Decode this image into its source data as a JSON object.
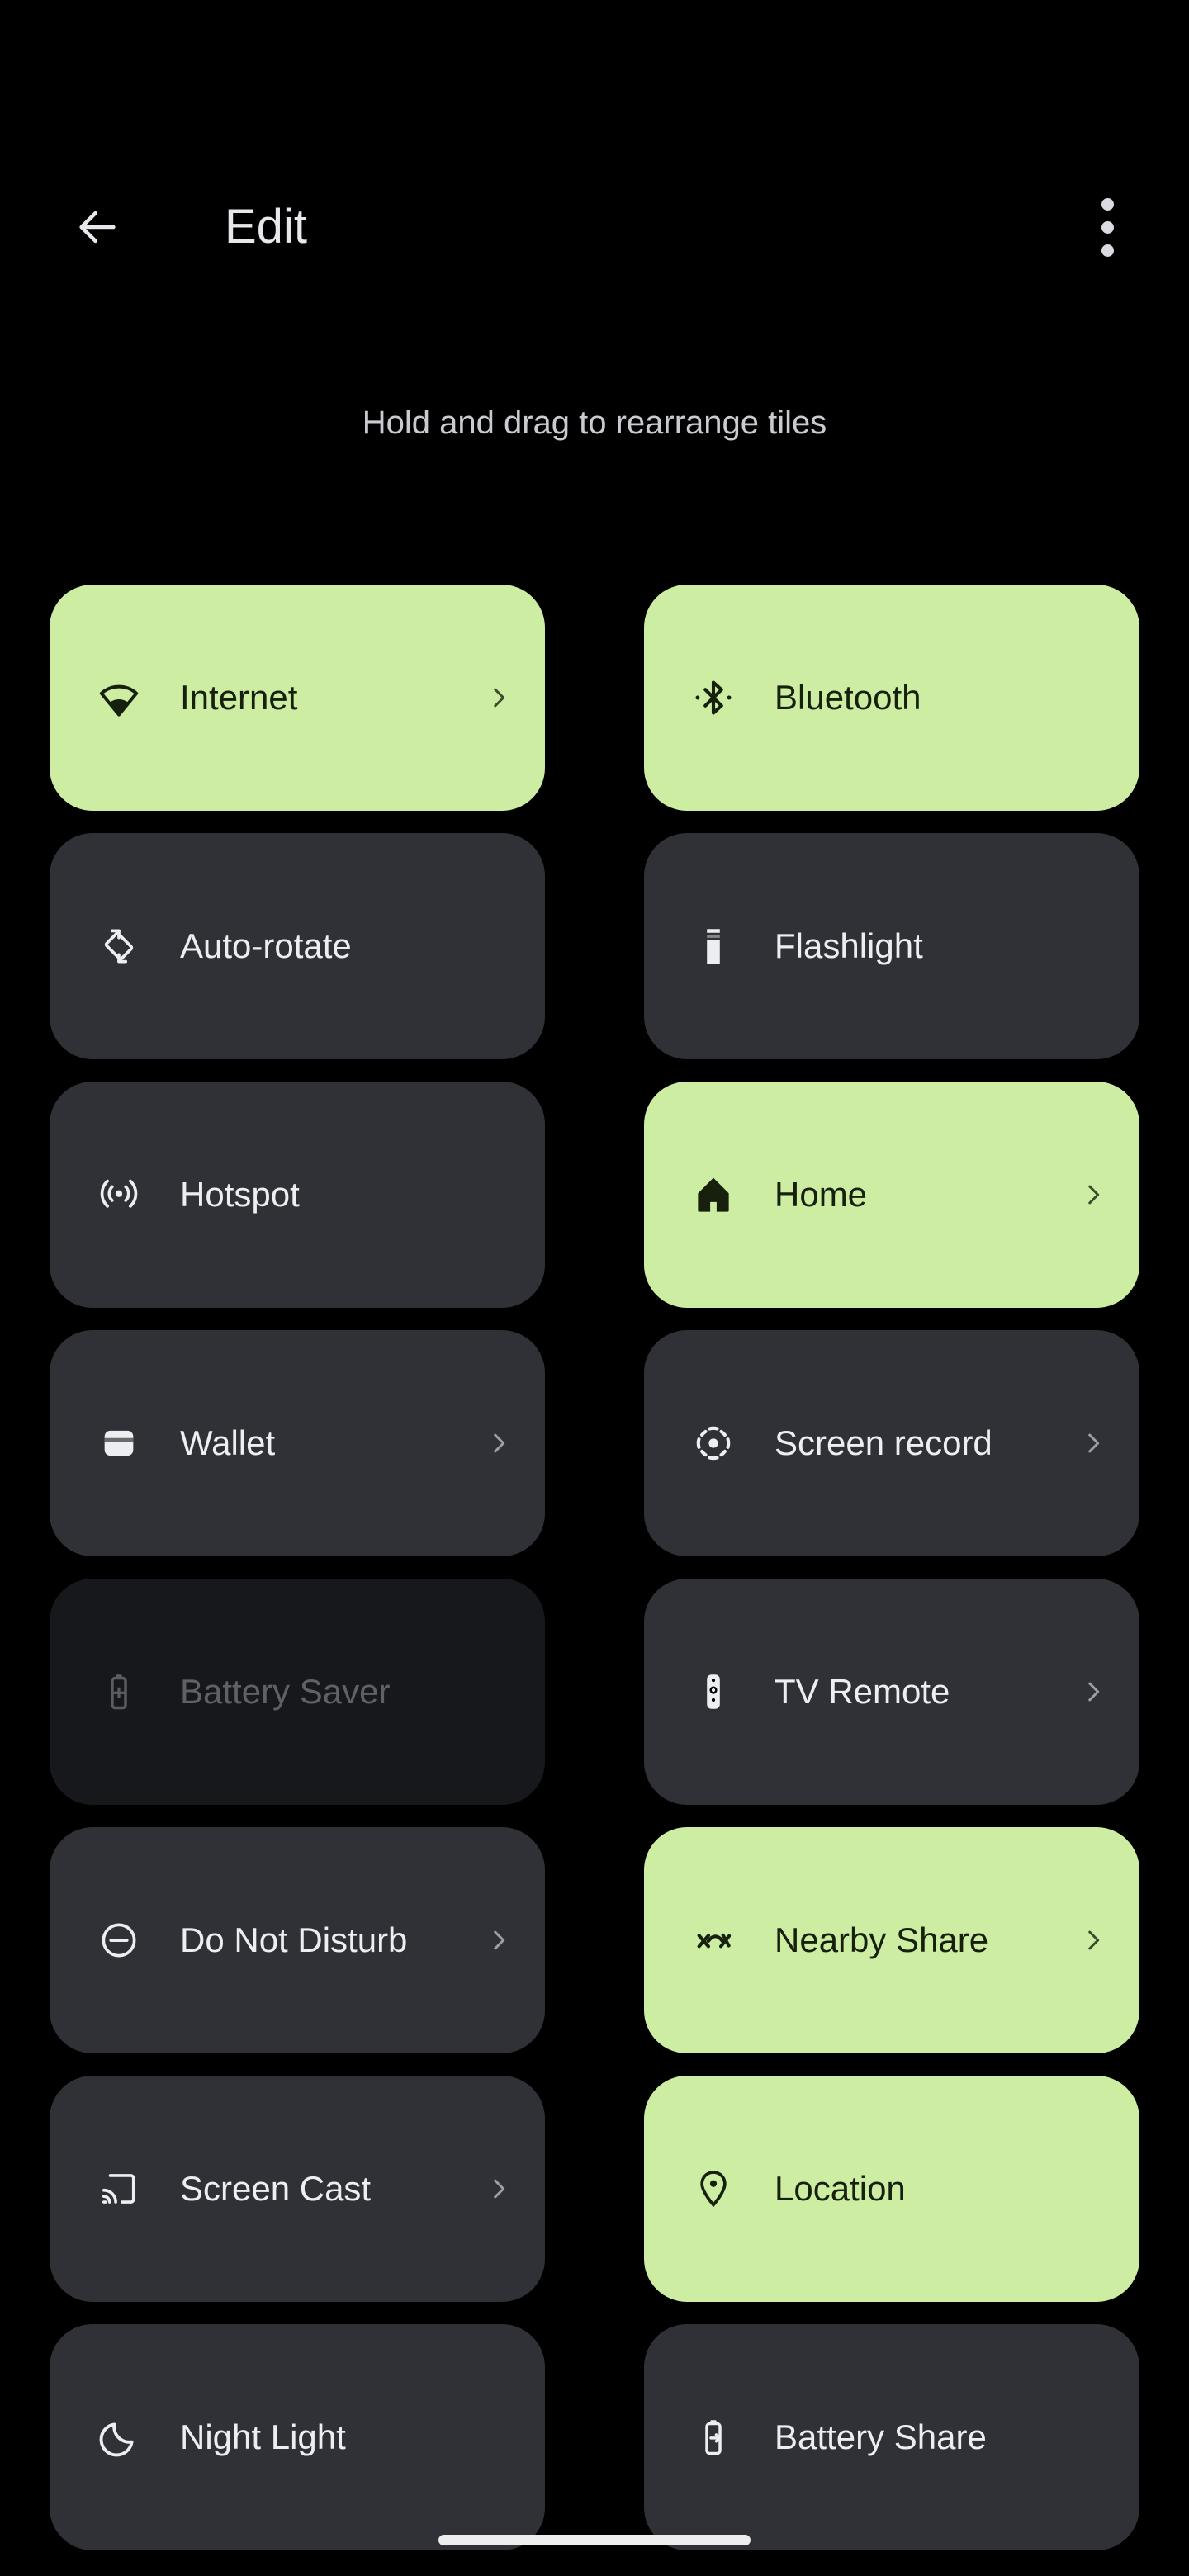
{
  "appbar": {
    "back_icon": "arrow-left-icon",
    "title": "Edit",
    "overflow_icon": "more-vert-icon"
  },
  "subtitle": "Hold and drag to rearrange tiles",
  "colors": {
    "background": "#000000",
    "tile_active": "#CDEDA3",
    "tile_inactive": "#2F3136",
    "tile_disabled": "#17181C",
    "text_on_active": "#16200C",
    "text_on_inactive": "#EDEEF2",
    "text_disabled": "#5F6166",
    "title_text": "#E7E8EC",
    "subtitle_text": "#C9CBD1",
    "gesture_bar": "#EDEDED"
  },
  "tiles": [
    {
      "label": "Internet",
      "icon": "wifi-icon",
      "state": "active",
      "chevron": true
    },
    {
      "label": "Bluetooth",
      "icon": "bluetooth-icon",
      "state": "active",
      "chevron": false
    },
    {
      "label": "Auto-rotate",
      "icon": "auto-rotate-icon",
      "state": "inactive",
      "chevron": false
    },
    {
      "label": "Flashlight",
      "icon": "flashlight-icon",
      "state": "inactive",
      "chevron": false
    },
    {
      "label": "Hotspot",
      "icon": "hotspot-icon",
      "state": "inactive",
      "chevron": false
    },
    {
      "label": "Home",
      "icon": "home-icon",
      "state": "active",
      "chevron": true
    },
    {
      "label": "Wallet",
      "icon": "wallet-icon",
      "state": "inactive",
      "chevron": true
    },
    {
      "label": "Screen record",
      "icon": "screen-record-icon",
      "state": "inactive",
      "chevron": true
    },
    {
      "label": "Battery Saver",
      "icon": "battery-saver-icon",
      "state": "disabled",
      "chevron": false
    },
    {
      "label": "TV Remote",
      "icon": "tv-remote-icon",
      "state": "inactive",
      "chevron": true
    },
    {
      "label": "Do Not Disturb",
      "icon": "do-not-disturb-icon",
      "state": "inactive",
      "chevron": true
    },
    {
      "label": "Nearby Share",
      "icon": "nearby-share-icon",
      "state": "active",
      "chevron": true
    },
    {
      "label": "Screen Cast",
      "icon": "screen-cast-icon",
      "state": "inactive",
      "chevron": true
    },
    {
      "label": "Location",
      "icon": "location-icon",
      "state": "active",
      "chevron": false
    },
    {
      "label": "Night Light",
      "icon": "night-light-icon",
      "state": "inactive",
      "chevron": false
    },
    {
      "label": "Battery Share",
      "icon": "battery-share-icon",
      "state": "inactive",
      "chevron": false
    }
  ],
  "gesture_bar": {
    "name": "home-gesture-bar"
  }
}
